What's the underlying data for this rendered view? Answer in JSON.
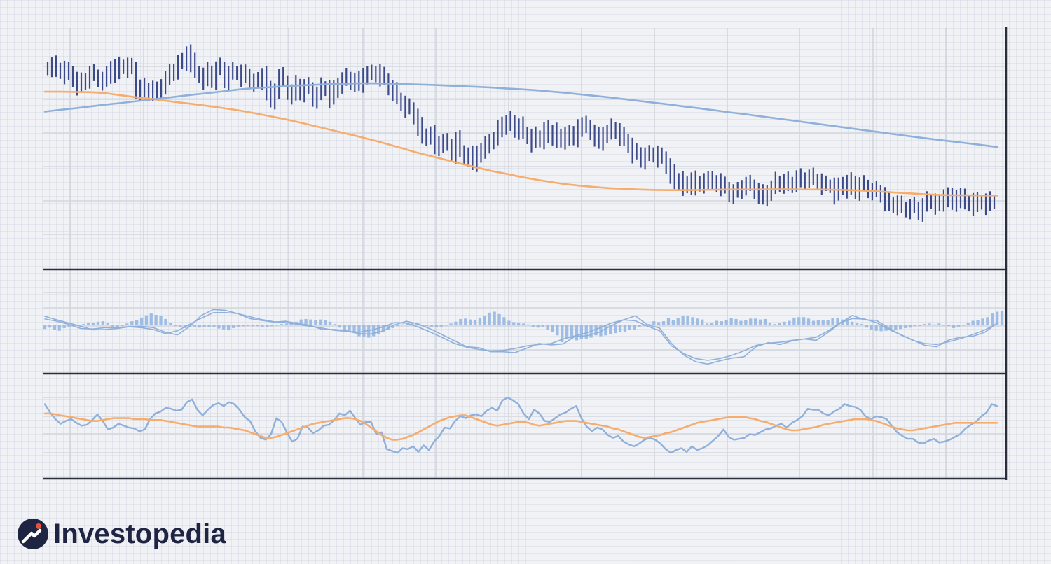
{
  "brand": {
    "name": "Investopedia",
    "logo_icon": "investopedia-logo-icon"
  },
  "colors": {
    "background": "#f1f2f5",
    "price_bars": "#3d4a8a",
    "ma_short": "#f6ac6c",
    "ma_long": "#8fb0da",
    "indicator_line": "#8fb0da",
    "histogram": "#9fbde4",
    "signal_line": "#f6ac6c",
    "axes": "#2a2d3a"
  },
  "chart_data": [
    {
      "type": "ohlc",
      "panel": "price",
      "title": "",
      "xlabel": "",
      "ylabel": "",
      "grid": true,
      "x": [
        0,
        140
      ],
      "ylim": [
        0,
        100
      ],
      "close": [
        88.5,
        89.5,
        86.8,
        88.0,
        85.3,
        86.6,
        83.0,
        80.2,
        81.8,
        83.3,
        85.5,
        84.9,
        83.0,
        82.4,
        84.6,
        88.8,
        85.8,
        89.0,
        89.4,
        88.0,
        88.4,
        77.7,
        79.5,
        76.6,
        79.0,
        77.7,
        76.6,
        80.6,
        83.3,
        85.8,
        87.4,
        90.6,
        90.3,
        95.4,
        90.7,
        86.5,
        84.9,
        82.6,
        86.7,
        82.7,
        87.7,
        88.5,
        82.6,
        85.6,
        86.5,
        86.2,
        84.0,
        85.4,
        82.1,
        82.0,
        81.8,
        85.6,
        78.0,
        73.0,
        78.6,
        84.2,
        82.3,
        77.3,
        76.1,
        80.7,
        77.1,
        79.7,
        79.2,
        74.2,
        76.3,
        79.6,
        79.1,
        74.3,
        78.2,
        81.0,
        82.8,
        83.9,
        81.7,
        82.6,
        80.5,
        85.7,
        85.2,
        85.3,
        86.6,
        84.3,
        83.1,
        79.4,
        77.5,
        74.4,
        72.2,
        69.9,
        70.1,
        66.3,
        61.7,
        56.6,
        58.3,
        58.0,
        51.9,
        54.9,
        54.4,
        53.4,
        49.3,
        55.7,
        50.7,
        47.8,
        48.8,
        44.7,
        50.6,
        49.8,
        53.1,
        55.9,
        55.9,
        60.4,
        63.6,
        62.4,
        64.4,
        60.2,
        61.9,
        58.8,
        57.3,
        54.5,
        57.4,
        55.9,
        60.3,
        56.7,
        60.0,
        56.4,
        54.9,
        59.0,
        57.6,
        55.9,
        62.5,
        61.5,
        62.2,
        59.2,
        57.1,
        54.3,
        59.0,
        58.5,
        61.0,
        59.8,
        57.3,
        55.7,
        53.2,
        49.5,
        49.8,
        46.7,
        48.8,
        49.0,
        49.7,
        47.6,
        47.9,
        43.9,
        40.3,
        36.1,
        38.1,
        34.8,
        34.2,
        38.4,
        35.0,
        35.0,
        38.1,
        37.2,
        35.6,
        37.2,
        34.7,
        34.1,
        31.0,
        32.2,
        32.3,
        35.0,
        35.5,
        35.2,
        32.6,
        31.3,
        29.1,
        32.6,
        33.9,
        36.9,
        35.8,
        37.0,
        35.2,
        36.4,
        38.5,
        36.9,
        38.4,
        38.8,
        37.8,
        37.1,
        35.2,
        35.2,
        35.2,
        30.9,
        34.3,
        36.4,
        33.6,
        36.7,
        32.6,
        35.4,
        35.1,
        32.9,
        32.8,
        32.6,
        30.9,
        27.8,
        26.2,
        27.1,
        26.1,
        25.1,
        24.2,
        25.4,
        25.2,
        23.1,
        25.9,
        28.1,
        28.0,
        26.3,
        26.8,
        30.8,
        29.7,
        26.7,
        30.6,
        29.3,
        26.9,
        28.2,
        25.7,
        27.7,
        28.0,
        26.2,
        28.1,
        28.2
      ],
      "series": [
        {
          "name": "",
          "values": [
            77.5,
            77.5,
            77.4,
            77.3,
            76.9,
            76.0,
            75.1,
            74.4,
            73.5,
            72.7,
            71.9,
            71.0,
            70.1,
            69.1,
            67.9,
            66.6,
            65.3,
            63.8,
            62.2,
            60.6,
            59.0,
            57.4,
            55.7,
            53.9,
            52.0,
            50.0,
            48.3,
            46.6,
            44.9,
            43.3,
            41.7,
            40.4,
            39.0,
            37.8,
            36.7,
            35.7,
            35.0,
            34.4,
            33.9,
            33.6,
            33.3,
            33.1,
            33.0,
            33.0,
            33.1,
            33.2,
            33.3,
            33.3,
            33.3,
            33.4,
            33.4,
            33.3,
            33.3,
            33.2,
            33.0,
            32.8,
            32.4,
            32.0,
            31.6,
            31.2,
            30.9,
            30.7,
            30.7,
            30.6,
            30.6
          ],
          "color": "#f6ac6c"
        },
        {
          "name": "",
          "values": [
            68.5,
            69.3,
            70.0,
            70.8,
            71.6,
            72.3,
            73.1,
            73.9,
            74.6,
            75.4,
            76.2,
            76.9,
            77.7,
            78.5,
            79.1,
            79.5,
            79.9,
            80.3,
            80.6,
            80.9,
            81.1,
            81.3,
            81.3,
            81.2,
            81.0,
            80.8,
            80.6,
            80.3,
            80.0,
            79.7,
            79.4,
            79.0,
            78.6,
            78.2,
            77.6,
            77.0,
            76.3,
            75.6,
            74.9,
            74.1,
            73.3,
            72.5,
            71.7,
            70.8,
            70.0,
            69.1,
            68.2,
            67.4,
            66.5,
            65.6,
            64.7,
            63.8,
            62.9,
            62.0,
            61.1,
            60.2,
            59.3,
            58.4,
            57.5,
            56.6,
            55.8,
            55.0,
            54.2,
            53.4,
            52.5
          ],
          "color": "#8fb0da"
        }
      ]
    },
    {
      "type": "macd",
      "panel": "momentum",
      "title": "",
      "grid": true,
      "ylim": [
        -1,
        1
      ],
      "histogram": [
        -0.08,
        -0.05,
        -0.1,
        -0.12,
        -0.06,
        -0.03,
        -0.02,
        0.01,
        0.03,
        0.06,
        0.05,
        0.08,
        0.09,
        0.06,
        -0.03,
        -0.06,
        -0.01,
        0.04,
        0.09,
        0.11,
        0.17,
        0.22,
        0.26,
        0.23,
        0.21,
        0.14,
        0.06,
        -0.01,
        -0.04,
        -0.06,
        -0.04,
        -0.03,
        -0.05,
        -0.03,
        -0.04,
        -0.03,
        -0.07,
        -0.09,
        -0.11,
        -0.06,
        -0.03,
        -0.02,
        -0.01,
        -0.02,
        -0.02,
        -0.03,
        -0.04,
        -0.02,
        0.01,
        0.03,
        0.04,
        0.07,
        0.08,
        0.13,
        0.14,
        0.13,
        0.12,
        0.13,
        0.11,
        0.08,
        0.03,
        -0.05,
        -0.11,
        -0.14,
        -0.17,
        -0.24,
        -0.25,
        -0.27,
        -0.24,
        -0.2,
        -0.15,
        -0.1,
        -0.06,
        -0.01,
        0.02,
        0.05,
        0.05,
        0.05,
        0.01,
        -0.01,
        -0.03,
        -0.04,
        -0.03,
        0.01,
        0.04,
        0.08,
        0.14,
        0.15,
        0.13,
        0.12,
        0.17,
        0.2,
        0.28,
        0.3,
        0.25,
        0.18,
        0.1,
        0.07,
        0.05,
        0.04,
        0.02,
        -0.03,
        -0.05,
        -0.04,
        -0.1,
        -0.15,
        -0.22,
        -0.37,
        -0.29,
        -0.31,
        -0.33,
        -0.3,
        -0.29,
        -0.27,
        -0.22,
        -0.24,
        -0.22,
        -0.19,
        -0.17,
        -0.15,
        -0.14,
        -0.1,
        -0.1,
        -0.04,
        0.0,
        0.03,
        0.09,
        0.07,
        0.09,
        0.16,
        0.12,
        0.16,
        0.2,
        0.21,
        0.18,
        0.15,
        0.13,
        0.04,
        0.06,
        0.1,
        0.09,
        0.12,
        0.16,
        0.14,
        0.1,
        0.12,
        0.15,
        0.15,
        0.13,
        0.14,
        0.05,
        0.03,
        0.06,
        0.08,
        0.1,
        0.17,
        0.18,
        0.18,
        0.15,
        0.1,
        0.11,
        0.12,
        0.11,
        0.16,
        0.17,
        0.13,
        0.15,
        0.08,
        0.06,
        0.03,
        -0.05,
        -0.1,
        -0.12,
        -0.13,
        -0.12,
        -0.11,
        -0.11,
        -0.08,
        -0.06,
        -0.05,
        -0.02,
        0.0,
        0.03,
        0.04,
        0.02,
        0.04,
        0.01,
        -0.01,
        -0.06,
        -0.03,
        0.01,
        0.06,
        0.1,
        0.12,
        0.15,
        0.18,
        0.26,
        0.3,
        0.32
      ],
      "series": [
        {
          "name": "",
          "values": [
            0.2,
            0.12,
            0.05,
            -0.02,
            -0.1,
            -0.09,
            -0.07,
            -0.03,
            -0.02,
            -0.05,
            -0.15,
            -0.21,
            -0.03,
            0.22,
            0.35,
            0.33,
            0.26,
            0.15,
            0.11,
            0.07,
            0.09,
            0.04,
            0.0,
            -0.09,
            -0.09,
            -0.12,
            -0.18,
            -0.19,
            -0.13,
            0.01,
            0.09,
            0.03,
            -0.08,
            -0.21,
            -0.34,
            -0.47,
            -0.49,
            -0.58,
            -0.58,
            -0.6,
            -0.5,
            -0.4,
            -0.43,
            -0.41,
            -0.24,
            -0.23,
            -0.15,
            -0.01,
            0.12,
            0.21,
            0.01,
            -0.06,
            -0.4,
            -0.65,
            -0.8,
            -0.85,
            -0.78,
            -0.72,
            -0.69,
            -0.47,
            -0.38,
            -0.42,
            -0.34,
            -0.3,
            -0.33,
            -0.15,
            0.05,
            0.22,
            0.12,
            0.11,
            -0.06,
            -0.21,
            -0.32,
            -0.44,
            -0.47,
            -0.32,
            -0.26,
            -0.24,
            -0.15,
            0.05
          ],
          "color": "#8fb0da"
        },
        {
          "name": "",
          "values": [
            0.14,
            0.09,
            0.02,
            -0.07,
            -0.08,
            -0.05,
            -0.05,
            -0.03,
            -0.05,
            -0.09,
            -0.18,
            -0.12,
            0.02,
            0.16,
            0.28,
            0.28,
            0.26,
            0.19,
            0.13,
            0.08,
            0.06,
            0.02,
            -0.02,
            -0.06,
            -0.11,
            -0.13,
            -0.15,
            -0.11,
            -0.04,
            0.06,
            0.05,
            -0.04,
            -0.15,
            -0.27,
            -0.4,
            -0.48,
            -0.53,
            -0.56,
            -0.55,
            -0.51,
            -0.45,
            -0.42,
            -0.4,
            -0.3,
            -0.23,
            -0.16,
            -0.06,
            0.05,
            0.12,
            0.1,
            -0.02,
            -0.12,
            -0.45,
            -0.62,
            -0.73,
            -0.77,
            -0.73,
            -0.66,
            -0.56,
            -0.44,
            -0.39,
            -0.37,
            -0.33,
            -0.3,
            -0.26,
            -0.12,
            0.06,
            0.15,
            0.14,
            0.06,
            -0.09,
            -0.2,
            -0.33,
            -0.4,
            -0.42,
            -0.36,
            -0.29,
            -0.2,
            -0.1,
            0.04
          ],
          "color": "#8fb0da"
        }
      ]
    },
    {
      "type": "line",
      "panel": "oscillator",
      "title": "",
      "grid": true,
      "ylim": [
        0,
        100
      ],
      "series": [
        {
          "name": "",
          "values": [
            78,
            69,
            62,
            57,
            60,
            62,
            58,
            55,
            56,
            61,
            67,
            60,
            51,
            53,
            57,
            55,
            53,
            52,
            49,
            51,
            62,
            68,
            70,
            74,
            73,
            71,
            72,
            80,
            83,
            72,
            66,
            72,
            77,
            79,
            76,
            80,
            78,
            72,
            64,
            60,
            49,
            42,
            40,
            46,
            63,
            59,
            48,
            38,
            41,
            54,
            53,
            47,
            50,
            55,
            56,
            61,
            68,
            66,
            71,
            63,
            56,
            59,
            59,
            46,
            48,
            30,
            28,
            26,
            31,
            30,
            33,
            27,
            34,
            29,
            38,
            44,
            53,
            52,
            60,
            65,
            63,
            66,
            67,
            65,
            71,
            74,
            71,
            82,
            85,
            82,
            78,
            68,
            62,
            72,
            68,
            60,
            59,
            63,
            67,
            69,
            73,
            76,
            63,
            54,
            49,
            53,
            51,
            45,
            42,
            44,
            38,
            35,
            33,
            36,
            40,
            42,
            40,
            36,
            30,
            26,
            29,
            31,
            27,
            33,
            29,
            31,
            34,
            39,
            44,
            51,
            43,
            40,
            41,
            42,
            46,
            45,
            48,
            51,
            52,
            55,
            57,
            53,
            58,
            61,
            65,
            73,
            72,
            72,
            68,
            66,
            70,
            73,
            78,
            76,
            75,
            72,
            65,
            62,
            65,
            64,
            62,
            55,
            48,
            44,
            41,
            41,
            37,
            36,
            39,
            41,
            37,
            38,
            40,
            43,
            46,
            52,
            56,
            59,
            65,
            69,
            78,
            76
          ],
          "color": "#8fb0da"
        },
        {
          "name": "",
          "values": [
            68,
            68,
            67,
            66,
            65,
            64,
            63,
            62,
            61,
            60,
            60,
            61,
            62,
            63,
            63,
            63,
            63,
            62,
            62,
            62,
            61,
            61,
            61,
            60,
            59,
            58,
            57,
            56,
            55,
            54,
            54,
            54,
            54,
            54,
            53,
            53,
            52,
            51,
            50,
            48,
            46,
            44,
            42,
            42,
            43,
            45,
            47,
            49,
            51,
            53,
            55,
            57,
            58,
            59,
            60,
            61,
            62,
            63,
            63,
            62,
            60,
            57,
            53,
            49,
            45,
            42,
            40,
            40,
            41,
            43,
            45,
            48,
            51,
            54,
            57,
            60,
            62,
            64,
            65,
            66,
            66,
            64,
            62,
            60,
            58,
            56,
            55,
            56,
            57,
            58,
            59,
            59,
            58,
            56,
            55,
            56,
            57,
            58,
            59,
            60,
            60,
            60,
            59,
            58,
            57,
            56,
            55,
            54,
            52,
            51,
            49,
            47,
            45,
            43,
            42,
            43,
            44,
            45,
            47,
            48,
            50,
            52,
            54,
            56,
            58,
            59,
            60,
            61,
            62,
            63,
            64,
            64,
            64,
            64,
            63,
            62,
            60,
            59,
            57,
            55,
            53,
            51,
            50,
            50,
            51,
            52,
            53,
            54,
            56,
            57,
            58,
            59,
            60,
            61,
            62,
            62,
            62,
            61,
            60,
            58,
            56,
            54,
            52,
            51,
            50,
            50,
            51,
            52,
            53,
            54,
            55,
            56,
            57,
            58,
            58,
            58,
            58,
            58,
            58,
            58,
            58,
            58
          ],
          "color": "#f6ac6c"
        }
      ]
    }
  ]
}
